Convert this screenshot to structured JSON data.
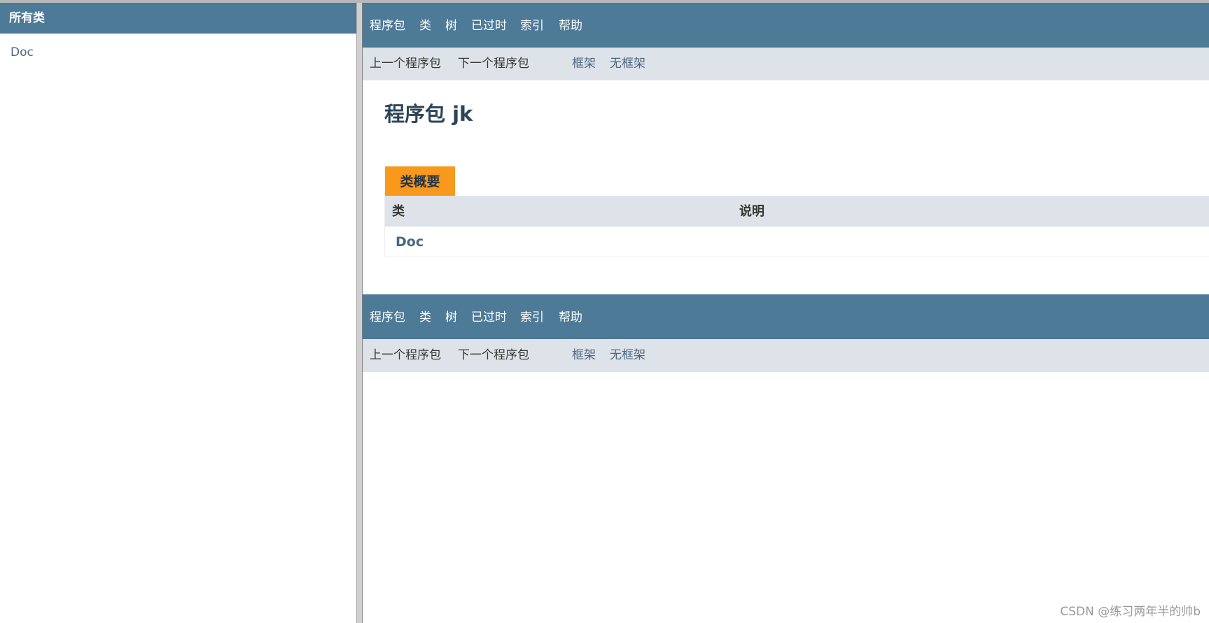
{
  "left_frame": {
    "header": "所有类",
    "classes": [
      "Doc"
    ]
  },
  "top_nav": {
    "items": [
      "程序包",
      "类",
      "树",
      "已过时",
      "索引",
      "帮助"
    ]
  },
  "sub_nav": {
    "prev_package": "上一个程序包",
    "next_package": "下一个程序包",
    "frames": "框架",
    "no_frames": "无框架"
  },
  "page": {
    "title": "程序包 jk",
    "summary_tab": "类概要",
    "columns": [
      "类",
      "说明"
    ],
    "rows": [
      {
        "class_name": "Doc",
        "description": ""
      }
    ]
  },
  "watermark": "CSDN @练习两年半的帅b",
  "colors": {
    "nav_bg": "#4d7a97",
    "subnav_bg": "#dee3e9",
    "tab_orange": "#f8981d",
    "link": "#4a6782",
    "title": "#2c4557"
  }
}
